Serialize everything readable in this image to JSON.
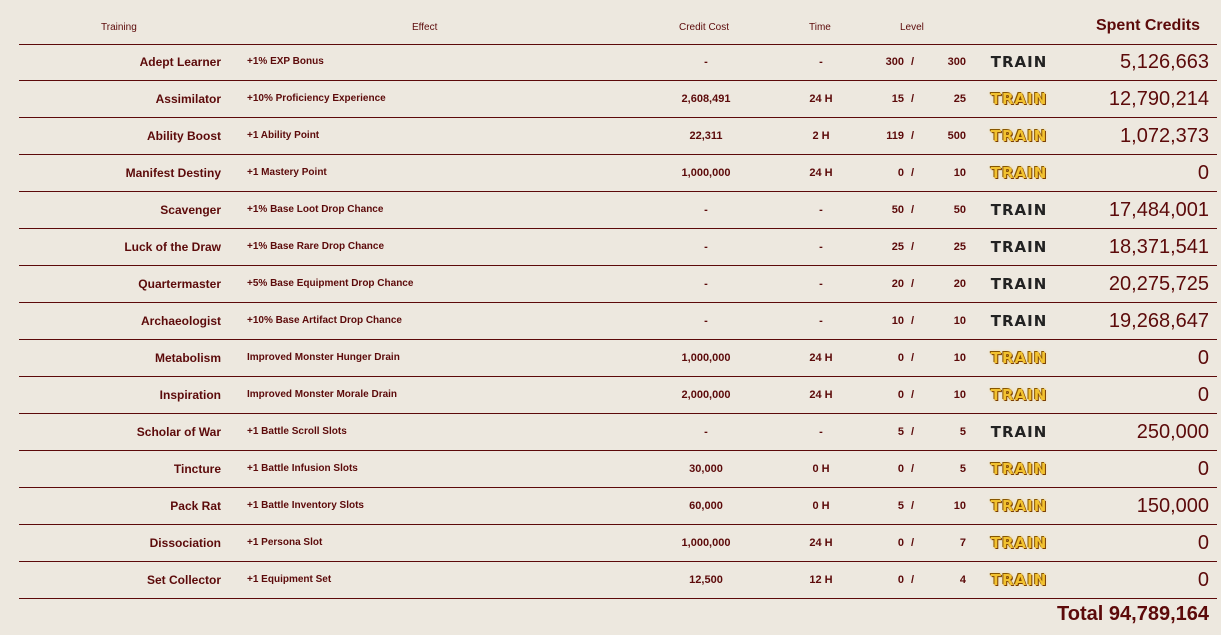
{
  "header": {
    "training": "Training",
    "effect": "Effect",
    "credit_cost": "Credit Cost",
    "time": "Time",
    "level": "Level",
    "spent_credits": "Spent Credits"
  },
  "train_label": "TRAIN",
  "slash": "/",
  "rows": [
    {
      "name": "Adept Learner",
      "effect": "+1% EXP Bonus",
      "cost": "-",
      "time": "-",
      "cur": "300",
      "max": "300",
      "train_active": false,
      "spent": "5,126,663"
    },
    {
      "name": "Assimilator",
      "effect": "+10% Proficiency Experience",
      "cost": "2,608,491",
      "time": "24 H",
      "cur": "15",
      "max": "25",
      "train_active": true,
      "spent": "12,790,214"
    },
    {
      "name": "Ability Boost",
      "effect": "+1 Ability Point",
      "cost": "22,311",
      "time": "2 H",
      "cur": "119",
      "max": "500",
      "train_active": true,
      "spent": "1,072,373"
    },
    {
      "name": "Manifest Destiny",
      "effect": "+1 Mastery Point",
      "cost": "1,000,000",
      "time": "24 H",
      "cur": "0",
      "max": "10",
      "train_active": true,
      "spent": "0"
    },
    {
      "name": "Scavenger",
      "effect": "+1% Base Loot Drop Chance",
      "cost": "-",
      "time": "-",
      "cur": "50",
      "max": "50",
      "train_active": false,
      "spent": "17,484,001"
    },
    {
      "name": "Luck of the Draw",
      "effect": "+1% Base Rare Drop Chance",
      "cost": "-",
      "time": "-",
      "cur": "25",
      "max": "25",
      "train_active": false,
      "spent": "18,371,541"
    },
    {
      "name": "Quartermaster",
      "effect": "+5% Base Equipment Drop Chance",
      "cost": "-",
      "time": "-",
      "cur": "20",
      "max": "20",
      "train_active": false,
      "spent": "20,275,725"
    },
    {
      "name": "Archaeologist",
      "effect": "+10% Base Artifact Drop Chance",
      "cost": "-",
      "time": "-",
      "cur": "10",
      "max": "10",
      "train_active": false,
      "spent": "19,268,647"
    },
    {
      "name": "Metabolism",
      "effect": "Improved Monster Hunger Drain",
      "cost": "1,000,000",
      "time": "24 H",
      "cur": "0",
      "max": "10",
      "train_active": true,
      "spent": "0"
    },
    {
      "name": "Inspiration",
      "effect": "Improved Monster Morale Drain",
      "cost": "2,000,000",
      "time": "24 H",
      "cur": "0",
      "max": "10",
      "train_active": true,
      "spent": "0"
    },
    {
      "name": "Scholar of War",
      "effect": "+1 Battle Scroll Slots",
      "cost": "-",
      "time": "-",
      "cur": "5",
      "max": "5",
      "train_active": false,
      "spent": "250,000"
    },
    {
      "name": "Tincture",
      "effect": "+1 Battle Infusion Slots",
      "cost": "30,000",
      "time": "0 H",
      "cur": "0",
      "max": "5",
      "train_active": true,
      "spent": "0"
    },
    {
      "name": "Pack Rat",
      "effect": "+1 Battle Inventory Slots",
      "cost": "60,000",
      "time": "0 H",
      "cur": "5",
      "max": "10",
      "train_active": true,
      "spent": "150,000"
    },
    {
      "name": "Dissociation",
      "effect": "+1 Persona Slot",
      "cost": "1,000,000",
      "time": "24 H",
      "cur": "0",
      "max": "7",
      "train_active": true,
      "spent": "0"
    },
    {
      "name": "Set Collector",
      "effect": "+1 Equipment Set",
      "cost": "12,500",
      "time": "12 H",
      "cur": "0",
      "max": "4",
      "train_active": true,
      "spent": "0"
    }
  ],
  "total": "Total 94,789,164",
  "colors": {
    "background": "#ede8df",
    "text": "#5c0a0a",
    "train_active": "#f2c230",
    "train_disabled": "#222222"
  }
}
